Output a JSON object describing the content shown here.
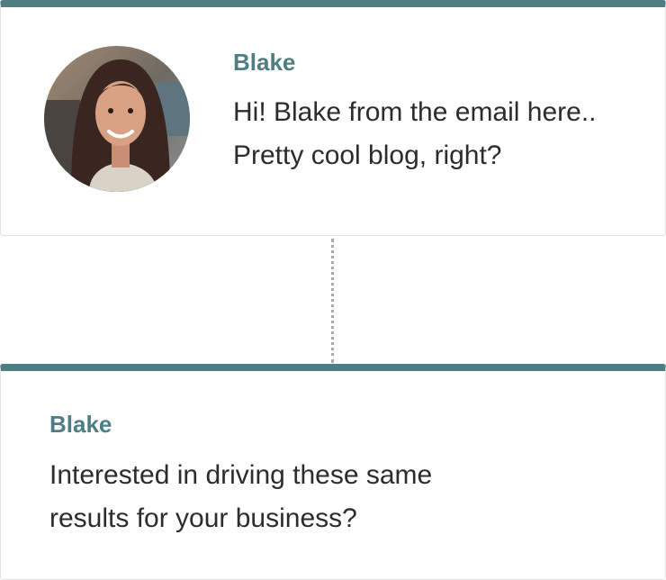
{
  "first_message": {
    "sender": "Blake",
    "lines": [
      "Hi! Blake from the email here..",
      "Pretty cool blog, right?"
    ]
  },
  "second_message": {
    "sender": "Blake",
    "lines": [
      "Interested in driving these same",
      "results for your business?"
    ]
  },
  "colors": {
    "accent": "#4f7d84",
    "text": "#2c2c2c"
  }
}
